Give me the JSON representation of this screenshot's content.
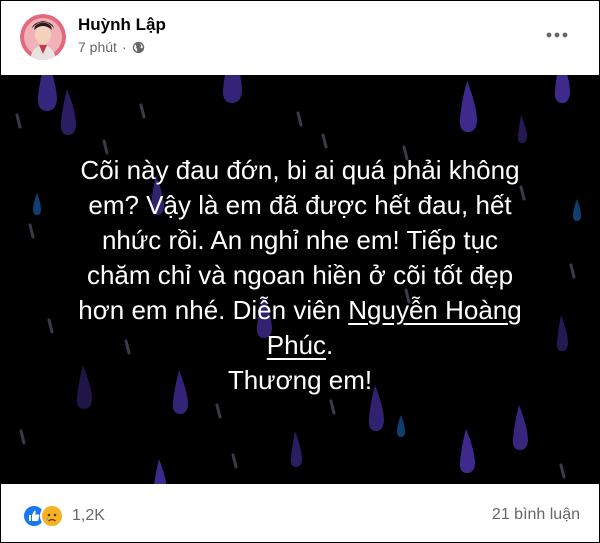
{
  "post": {
    "author": "Huỳnh Lập",
    "time": "7 phút",
    "separator": "·",
    "privacy_icon": "globe-icon",
    "more_icon": "more-horizontal-icon"
  },
  "content": {
    "lines": [
      "Cõi này đau đớn, bi ai quá phải không",
      "em? Vậy là em đã được hết đau, hết",
      "nhức rồi. An nghỉ nhe em! Tiếp tục",
      "chăm chỉ và ngoan hiền ở cõi tốt đẹp",
      "hơn em nhé. Diễn viên "
    ],
    "mention_part1": "Nguyễn Hoàng",
    "mention_part2": "Phúc",
    "after_mention": ".",
    "closing": "Thương em!",
    "background": "#000000",
    "raindrop_color": "#3d2a8c"
  },
  "footer": {
    "reaction_icons": [
      "like-icon",
      "sad-icon"
    ],
    "reaction_count": "1,2K",
    "comment_count": "21 bình luận"
  },
  "colors": {
    "like_blue": "#1877f2",
    "sad_yellow": "#f7b125",
    "meta_gray": "#65676b"
  }
}
